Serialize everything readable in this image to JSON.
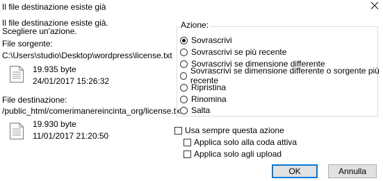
{
  "window": {
    "title": "Il file destinazione esiste già"
  },
  "intro": {
    "line1": "Il file destinazione esiste già.",
    "line2": "Scegliere un'azione."
  },
  "source": {
    "label": "File sorgente:",
    "path": "C:\\Users\\studio\\Desktop\\wordpress\\license.txt",
    "size": "19.935 byte",
    "date": "24/01/2017 15:26:32"
  },
  "destination": {
    "label": "File destinazione:",
    "path": "/public_html/comerimanereincinta_org/license.txt",
    "size": "19.930 byte",
    "date": "11/01/2017 21:20:50"
  },
  "action": {
    "legend": "Azione:",
    "options": [
      {
        "label": "Sovrascrivi",
        "selected": true
      },
      {
        "label": "Sovrascrivi se più recente",
        "selected": false
      },
      {
        "label": "Sovrascrivi se dimensione differente",
        "selected": false
      },
      {
        "label": "Sovrascrivi se dimensione differente o sorgente più recente",
        "selected": false
      },
      {
        "label": "Ripristina",
        "selected": false
      },
      {
        "label": "Rinomina",
        "selected": false
      },
      {
        "label": "Salta",
        "selected": false
      }
    ]
  },
  "checks": {
    "always": {
      "label": "Usa sempre questa azione",
      "checked": false
    },
    "queue": {
      "label": "Applica solo alla coda attiva",
      "checked": false
    },
    "upload": {
      "label": "Applica solo agli upload",
      "checked": false
    }
  },
  "buttons": {
    "ok": "OK",
    "cancel": "Annulla"
  },
  "colors": {
    "accent": "#0078d7",
    "button_bg": "#e1e1e1"
  }
}
